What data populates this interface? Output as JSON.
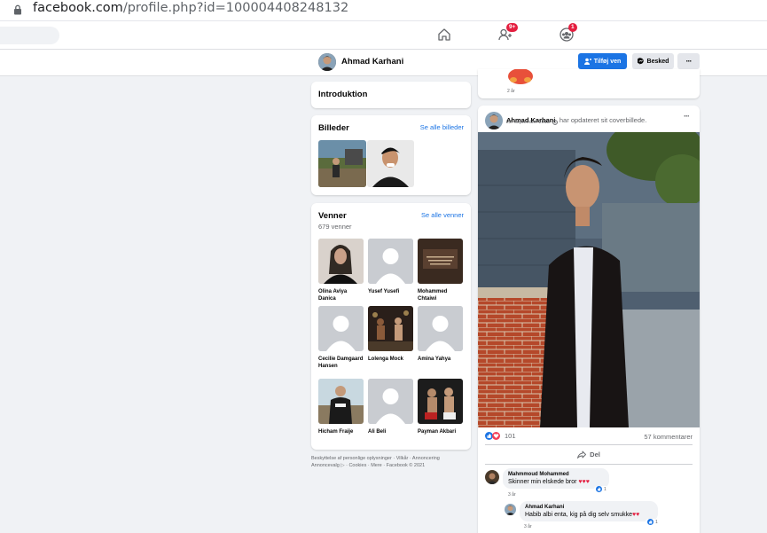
{
  "browser": {
    "url_domain": "facebook.com",
    "url_path": "/profile.php?id=100004408248132"
  },
  "nav": {
    "search_placeholder": "",
    "friends_badge": "9+",
    "notifications_badge": "1"
  },
  "profile_bar": {
    "name": "Ahmad Karhani",
    "add_friend_label": "Tilføj ven",
    "message_label": "Besked",
    "more_label": "···"
  },
  "intro": {
    "title": "Introduktion"
  },
  "photos": {
    "title": "Billeder",
    "see_all": "Se alle billeder"
  },
  "friends": {
    "title": "Venner",
    "count": "679 venner",
    "see_all": "Se alle venner",
    "items": [
      {
        "name": "Olina Aviya Danica"
      },
      {
        "name": "Yusef Yusefi"
      },
      {
        "name": "Mohammed Chtaiwi"
      },
      {
        "name": "Cecilie Damgaard Hansen"
      },
      {
        "name": "Lolenga Mock"
      },
      {
        "name": "Amina Yahya"
      },
      {
        "name": "Hicham Fraije"
      },
      {
        "name": "Ali Beli"
      },
      {
        "name": "Payman Akbari"
      }
    ]
  },
  "footer": {
    "line1": "Beskyttelse af personlige oplysninger · Vilkår · Annoncering",
    "line2": "Annoncevalg ▷ · Cookies · Mere · Facebook © 2021"
  },
  "prev_post": {
    "time": "2 år"
  },
  "post": {
    "author": "Ahmad Karhani",
    "action": "har opdateret sit coverbillede.",
    "date": "22. september 2018 · ",
    "more": "···",
    "reactions_count": "101",
    "comments_count": "57 kommentarer",
    "share_label": "Del",
    "comments": [
      {
        "name": "Mahmmoud Mohammed",
        "text": "Skinner min elskede bror",
        "time": "3 år",
        "reacts": "1"
      },
      {
        "name": "Ahmad Karhani",
        "text": "Habib albi enta, kig på dig selv smukke",
        "time": "3 år",
        "reacts": "1"
      }
    ]
  },
  "colors": {
    "accent": "#1b74e4",
    "badge": "#e41e3f",
    "background": "#f0f2f5"
  }
}
